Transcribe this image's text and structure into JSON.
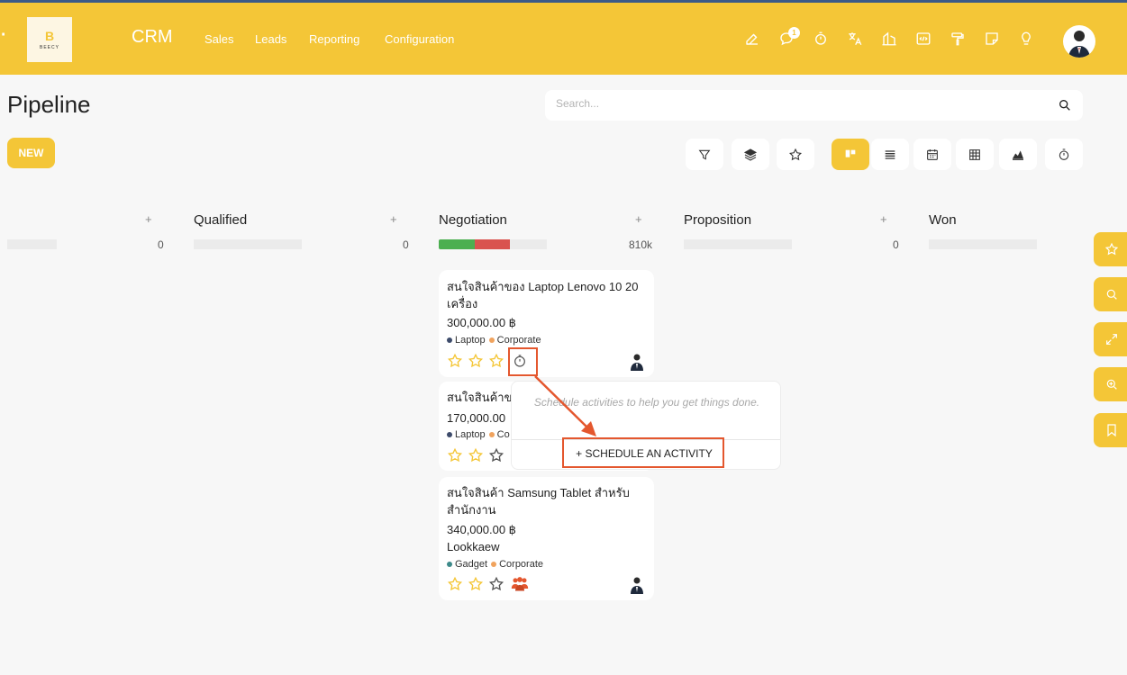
{
  "navbar": {
    "brand": "CRM",
    "logo_text": "BEECY",
    "menu": [
      "Sales",
      "Leads",
      "Reporting",
      "Configuration"
    ],
    "icons": [
      "edit-icon",
      "chat-icon",
      "timer-icon",
      "translate-icon",
      "building-icon",
      "code-icon",
      "paint-roller-icon",
      "note-icon",
      "lightbulb-icon"
    ],
    "chat_badge": "1",
    "bg_color": "#f4c637"
  },
  "page": {
    "title": "Pipeline",
    "search_placeholder": "Search...",
    "new_label": "NEW"
  },
  "toolbar": {
    "buttons": [
      "filter-icon",
      "layers-icon",
      "star-icon"
    ],
    "views": [
      "kanban-view-icon",
      "list-view-icon",
      "calendar-view-icon",
      "pivot-view-icon",
      "graph-view-icon",
      "activity-view-icon"
    ],
    "active_view": "kanban-view-icon"
  },
  "columns": [
    {
      "title": "",
      "count": "0"
    },
    {
      "title": "Qualified",
      "count": "0"
    },
    {
      "title": "Negotiation",
      "count": "810k",
      "progress": {
        "green": 0.33,
        "red": 0.33
      }
    },
    {
      "title": "Proposition",
      "count": "0"
    },
    {
      "title": "Won",
      "count": ""
    }
  ],
  "cards": [
    {
      "title": "สนใจสินค้าของ Laptop Lenovo 10 20 เครื่อง",
      "amount": "300,000.00 ฿",
      "tags": [
        {
          "name": "Laptop",
          "color": "#3d4b6b"
        },
        {
          "name": "Corporate",
          "color": "#f0a35e"
        }
      ],
      "stars": 3
    },
    {
      "title": "สนใจสินค้าขอ",
      "amount": "170,000.00",
      "tags": [
        {
          "name": "Laptop",
          "color": "#3d4b6b"
        },
        {
          "name": "Co",
          "color": "#f0a35e"
        }
      ],
      "stars": 2
    },
    {
      "title": "สนใจสินค้า Samsung Tablet สำหรับสำนักงาน",
      "amount": "340,000.00 ฿",
      "customer": "Lookkaew",
      "tags": [
        {
          "name": "Gadget",
          "color": "#3d8a8a"
        },
        {
          "name": "Corporate",
          "color": "#f0a35e"
        }
      ],
      "stars": 2
    }
  ],
  "popover": {
    "message": "Schedule activities to help you get things done.",
    "button": "+ SCHEDULE AN ACTIVITY"
  },
  "side_tabs": [
    "star-icon",
    "search-icon",
    "expand-icon",
    "zoom-icon",
    "bookmark-icon"
  ],
  "colors": {
    "accent": "#f4c637",
    "highlight": "#e4572e",
    "progress_green": "#4caf50",
    "progress_red": "#d9534f"
  }
}
